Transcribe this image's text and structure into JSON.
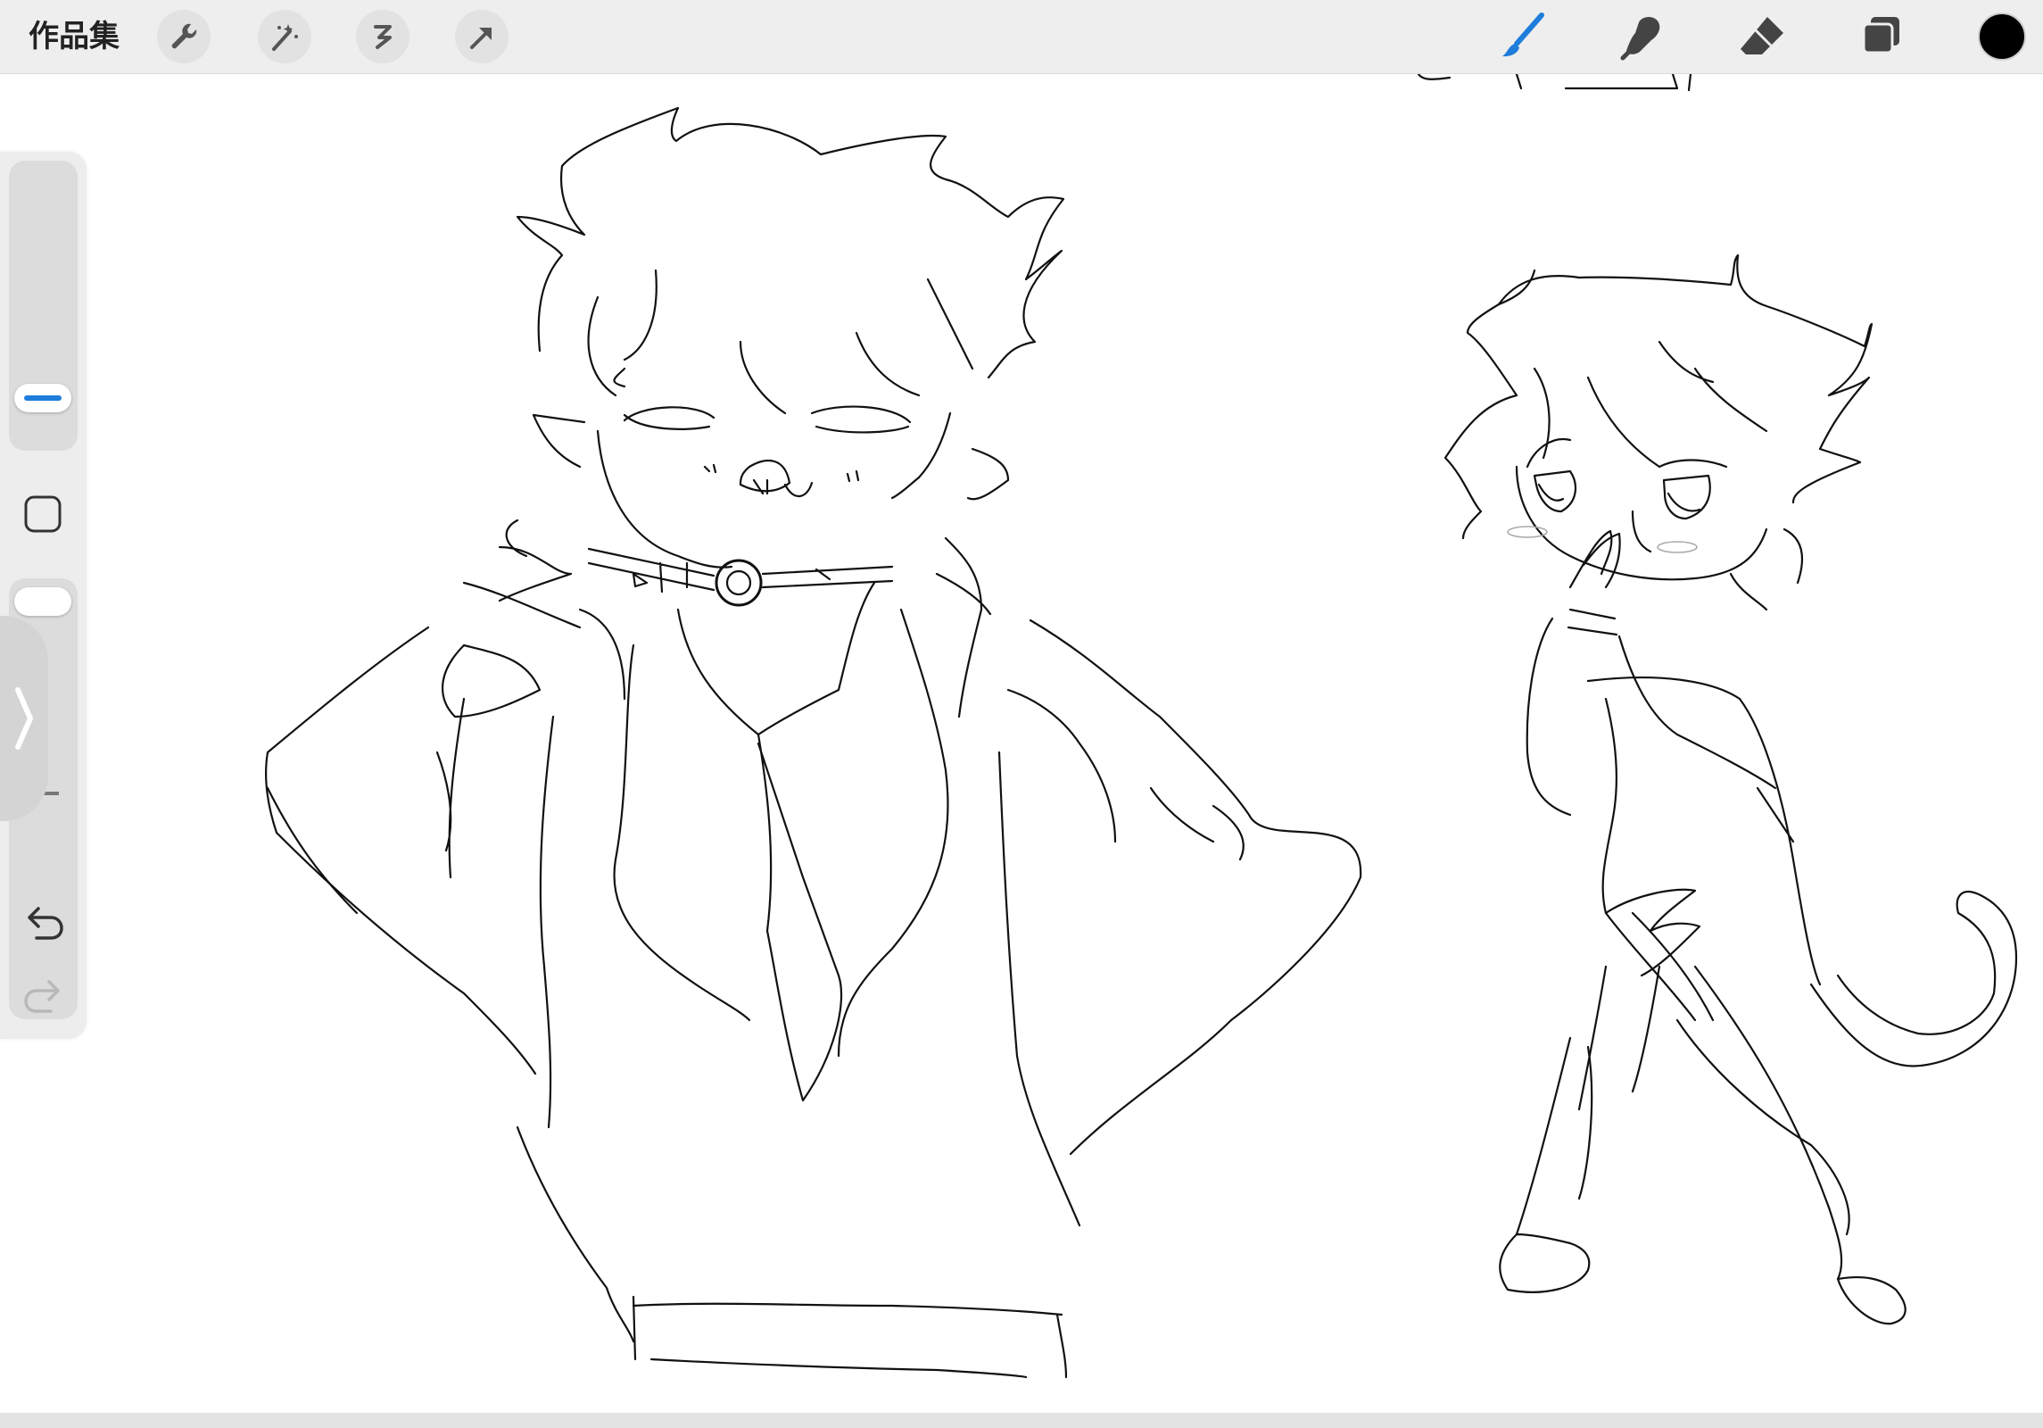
{
  "app": {
    "gallery_label": "作品集"
  },
  "toolbar": {
    "left_tools": [
      "wrench-icon",
      "magic-wand-icon",
      "selection-icon",
      "transform-arrow-icon"
    ],
    "right_tools": [
      "brush-icon",
      "smudge-icon",
      "eraser-icon",
      "layers-icon"
    ],
    "active_tool": "brush-icon",
    "accent_color": "#1e7ddb",
    "current_color": "#000000"
  },
  "sidebar": {
    "brush_size": 0.13,
    "opacity": 1.0,
    "controls": [
      "brush-size-slider",
      "modify-square-icon",
      "opacity-slider",
      "undo-icon",
      "redo-icon"
    ]
  }
}
